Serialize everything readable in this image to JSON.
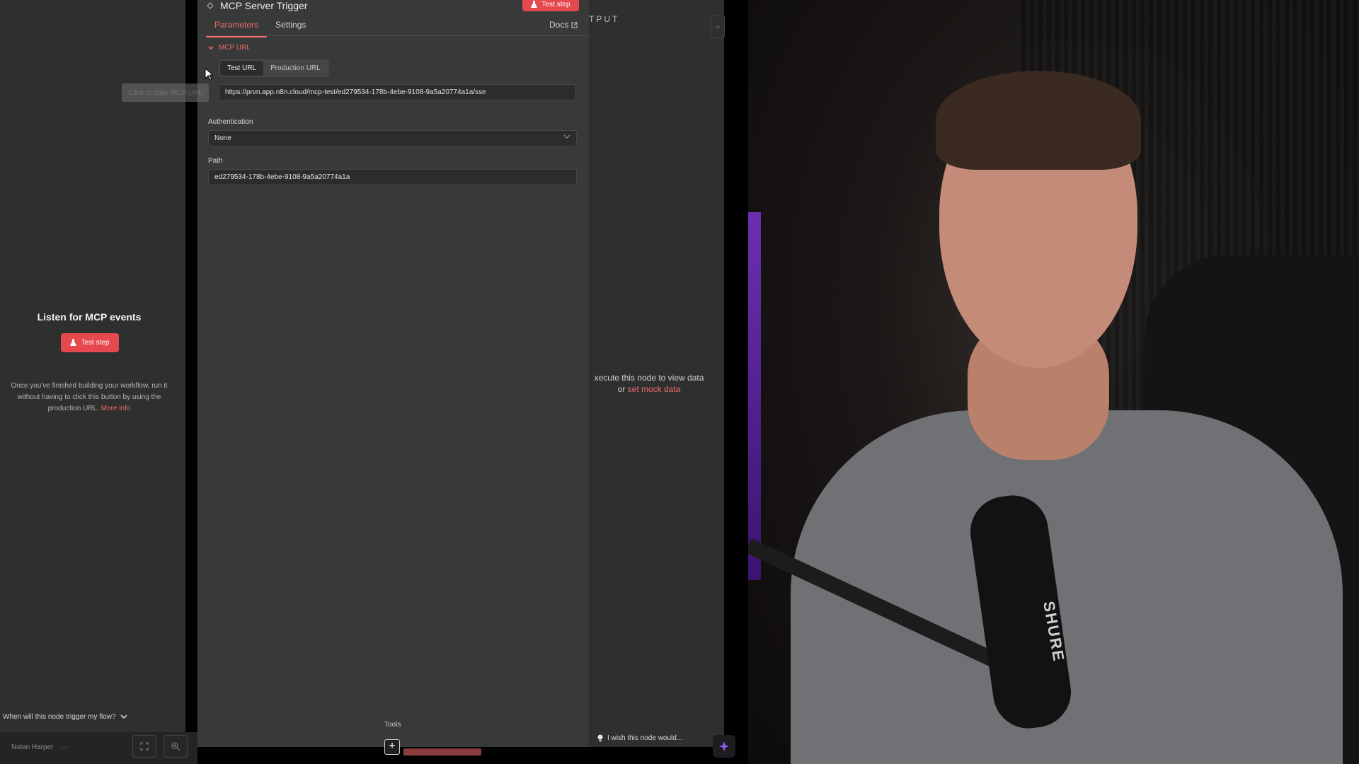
{
  "left_panel": {
    "listen_title": "Listen for MCP events",
    "test_step_label": "Test step",
    "hint_text": "Once you've finished building your workflow, run it without having to click this button by using the production URL.",
    "more_info_label": "More info",
    "trigger_question": "When will this node trigger my flow?"
  },
  "node": {
    "title": "MCP Server Trigger",
    "test_step_label": "Test step",
    "tabs": [
      {
        "label": "Parameters",
        "active": true
      },
      {
        "label": "Settings",
        "active": false
      }
    ],
    "docs_label": "Docs",
    "mcp_url_heading": "MCP URL",
    "url_toggle": {
      "test_label": "Test URL",
      "production_label": "Production URL",
      "selected": "Test URL"
    },
    "copy_tooltip": "Click to copy MCP URL",
    "mcp_url_value": "https://prvn.app.n8n.cloud/mcp-test/ed279534-178b-4ebe-9108-9a5a20774a1a/sse",
    "authentication_label": "Authentication",
    "authentication_value": "None",
    "path_label": "Path",
    "path_value": "ed279534-178b-4ebe-9108-9a5a20774a1a",
    "tools_label": "Tools"
  },
  "output_panel": {
    "title_fragment": "TPUT",
    "execute_hint": "xecute this node to view data",
    "or_label": "or",
    "mock_data_label": "set mock data",
    "wish_label": "I wish this node would..."
  },
  "bottom_bar": {
    "user_name": "Nolan Harper",
    "more_label": "···"
  },
  "webcam": {
    "mic_brand": "SHURE"
  },
  "colors": {
    "accent_red": "#e5484d",
    "link_red": "#ef6a6a",
    "panel_bg": "#383a3a",
    "side_bg": "#2e3030"
  },
  "icons": [
    "mcp-node-icon",
    "flask-icon",
    "external-link-icon",
    "chevron-down-icon",
    "cursor-icon",
    "plus-icon",
    "lightbulb-icon",
    "sparkle-icon",
    "fullscreen-icon",
    "zoom-in-icon"
  ]
}
